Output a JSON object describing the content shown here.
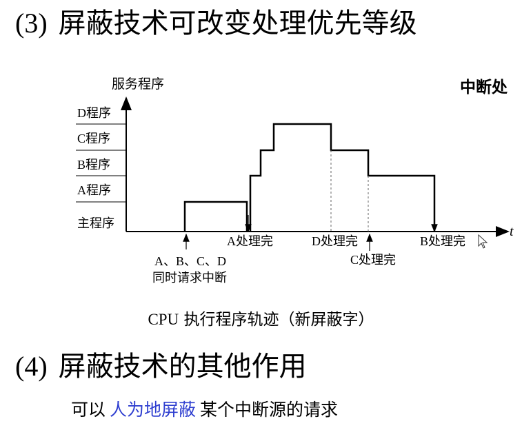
{
  "heading3": {
    "number": "(3)",
    "text": "屏蔽技术可改变处理优先等级"
  },
  "side_title": "中断处",
  "diagram": {
    "y_axis_label": "服务程序",
    "x_axis_label": "t",
    "levels": [
      "D程序",
      "C程序",
      "B程序",
      "A程序",
      "主程序"
    ],
    "events": {
      "a_done": "A处理完",
      "d_done": "D处理完",
      "c_done": "C处理完",
      "b_done": "B处理完",
      "request_line1": "A、B、C、D",
      "request_line2": "同时请求中断"
    },
    "cursor_icon": "mouse-pointer-icon"
  },
  "caption": {
    "cpu": "CPU",
    "text": "执行程序轨迹（新屏蔽字）"
  },
  "heading4": {
    "number": "(4)",
    "text": "屏蔽技术的其他作用"
  },
  "body": {
    "before": "可以",
    "highlight": "人为地屏蔽",
    "after": "某个中断源的请求",
    "highlight_color": "#2f3fd0"
  }
}
